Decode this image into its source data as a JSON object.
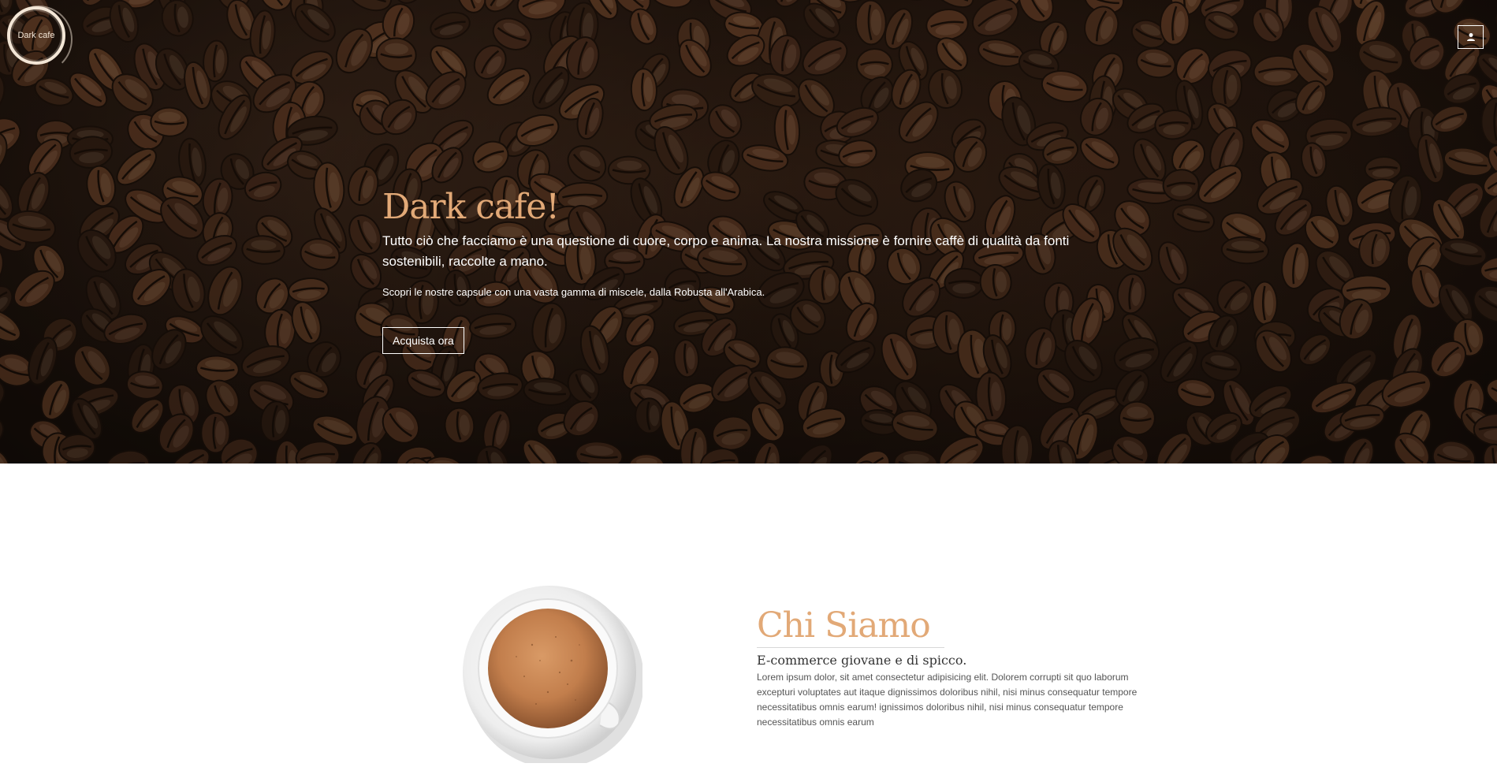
{
  "header": {
    "logo_text": "Dark cafe",
    "user_icon": "user-icon"
  },
  "hero": {
    "title": "Dark cafe!",
    "description": "Tutto ciò che facciamo è una questione di cuore, corpo e anima. La nostra missione è fornire caffè di qualità da fonti sostenibili, raccolte a mano.",
    "subtext": "Scopri le nostre capsule con una vasta gamma di miscele, dalla Robusta all'Arabica.",
    "cta_label": "Acquista ora"
  },
  "about": {
    "title": "Chi Siamo",
    "subtitle": "E-commerce giovane e di spicco.",
    "text": "Lorem ipsum dolor, sit amet consectetur adipisicing elit. Dolorem corrupti sit quo laborum excepturi voluptates aut itaque dignissimos doloribus nihil, nisi minus consequatur tempore necessitatibus omnis earum! ignissimos doloribus nihil, nisi minus consequatur tempore necessitatibus omnis earum"
  },
  "colors": {
    "accent": "#e2a977",
    "hero_bg": "#2a1a10"
  }
}
